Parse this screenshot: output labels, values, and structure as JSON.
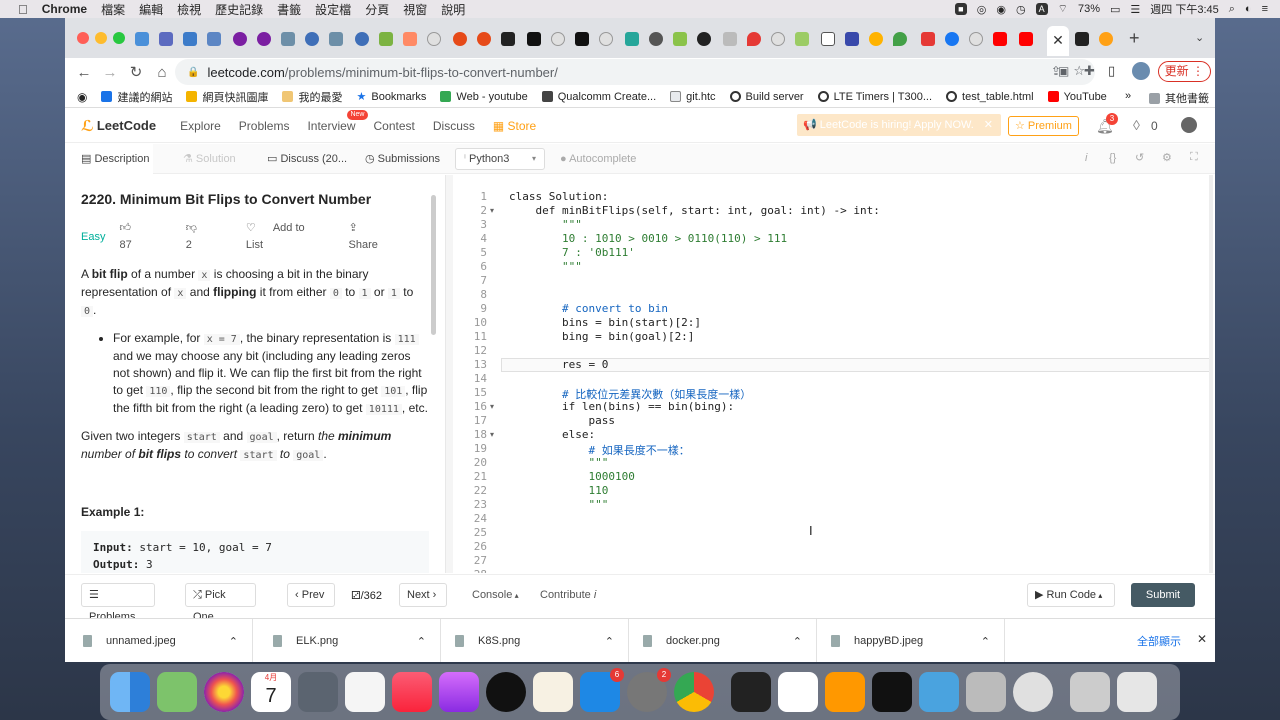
{
  "menubar": {
    "app_name": "Chrome",
    "items": [
      "檔案",
      "編輯",
      "檢視",
      "歷史記錄",
      "書籤",
      "設定檔",
      "分頁",
      "視窗",
      "說明"
    ],
    "battery": "73%",
    "clock": "週四 下午3:45"
  },
  "browser": {
    "url_domain": "leetcode.com",
    "url_path": "/problems/minimum-bit-flips-to-convert-number/",
    "update_label": "更新",
    "bookmarks": [
      "建議的網站",
      "網頁快訊圖庫",
      "我的最愛",
      "Bookmarks",
      "Web - youtube",
      "Qualcomm Create...",
      "git.htc",
      "Build server",
      "LTE Timers | T300...",
      "test_table.html",
      "YouTube"
    ],
    "other_bookmarks": "其他書籤"
  },
  "leetcode": {
    "logo": "LeetCode",
    "nav": [
      "Explore",
      "Problems",
      "Interview",
      "Contest",
      "Discuss"
    ],
    "interview_badge": "New",
    "store": "Store",
    "hiring": "LeetCode is hiring! Apply NOW.",
    "premium": "Premium",
    "notif_count": "3",
    "coins": "0"
  },
  "panel_tabs": {
    "description": "Description",
    "solution": "Solution",
    "discuss": "Discuss (20...",
    "submissions": "Submissions",
    "language": "Python3",
    "autocomplete": "Autocomplete"
  },
  "problem": {
    "title": "2220. Minimum Bit Flips to Convert Number",
    "difficulty": "Easy",
    "likes": "87",
    "dislikes": "2",
    "add_to_list": "Add to List",
    "share": "Share",
    "p1_a": "A ",
    "p1_b": "bit flip",
    "p1_c": " of a number ",
    "p1_code_x": "x",
    "p1_d": " is choosing a bit in the binary representation of ",
    "p1_e": " and ",
    "p1_f": "flipping",
    "p1_g": " it from either ",
    "p1_code_0": "0",
    "p1_h": " to ",
    "p1_code_1": "1",
    "p1_i": " or ",
    "p1_j": " to ",
    "p1_k": ".",
    "bullet_a": "For example, for ",
    "bullet_code_x7": "x = 7",
    "bullet_b": ", the binary representation is ",
    "bullet_code_111": "111",
    "bullet_c": " and we may choose any bit (including any leading zeros not shown) and flip it. We can flip the first bit from the right to get ",
    "bullet_code_110": "110",
    "bullet_d": ", flip the second bit from the right to get ",
    "bullet_code_101": "101",
    "bullet_e": ", flip the fifth bit from the right (a leading zero) to get ",
    "bullet_code_10111": "10111",
    "bullet_f": ", etc.",
    "p2_a": "Given two integers ",
    "p2_code_start": "start",
    "p2_b": " and ",
    "p2_code_goal": "goal",
    "p2_c": ", return ",
    "p2_d": "the ",
    "p2_e": "minimum",
    "p2_f": " number of ",
    "p2_g": "bit flips",
    "p2_h": " to convert ",
    "p2_i": " to ",
    "p2_j": ".",
    "example_title": "Example 1:",
    "ex_input_label": "Input:",
    "ex_input": " start = 10, goal = 7",
    "ex_output_label": "Output:",
    "ex_output": " 3"
  },
  "code_lines": [
    "class Solution:",
    "    def minBitFlips(self, start: int, goal: int) -> int:",
    "        \"\"\"",
    "        10 : 1010 > 0010 > 0110(110) > 111",
    "        7 : '0b111'",
    "        \"\"\"",
    "",
    "",
    "        # convert to bin",
    "        bins = bin(start)[2:]",
    "        bing = bin(goal)[2:]",
    "",
    "        res = 0",
    "",
    "        # 比較位元差異次數（如果長度一樣）",
    "        if len(bins) == bin(bing):",
    "            pass",
    "        else:",
    "            # 如果長度不一樣：",
    "            \"\"\"",
    "            1000100",
    "            110",
    "            \"\"\"",
    "",
    "",
    "",
    "",
    ""
  ],
  "code_line_numbers": [
    "1",
    "2",
    "3",
    "4",
    "5",
    "6",
    "7",
    "8",
    "9",
    "10",
    "11",
    "12",
    "13",
    "14",
    "15",
    "16",
    "17",
    "18",
    "19",
    "20",
    "21",
    "22",
    "23",
    "24",
    "25",
    "26",
    "27",
    "28"
  ],
  "bottom": {
    "problems": "Problems",
    "pick_one": "Pick One",
    "prev": "Prev",
    "page": "/362",
    "next": "Next",
    "console": "Console",
    "contribute": "Contribute",
    "run": "Run Code",
    "submit": "Submit"
  },
  "downloads": {
    "files": [
      "unnamed.jpeg",
      "ELK.png",
      "K8S.png",
      "docker.png",
      "happyBD.jpeg"
    ],
    "show_all": "全部顯示"
  },
  "dock": {
    "calendar_month": "4月",
    "calendar_day": "7",
    "appstore_badge": "6",
    "prefs_badge": "2"
  }
}
